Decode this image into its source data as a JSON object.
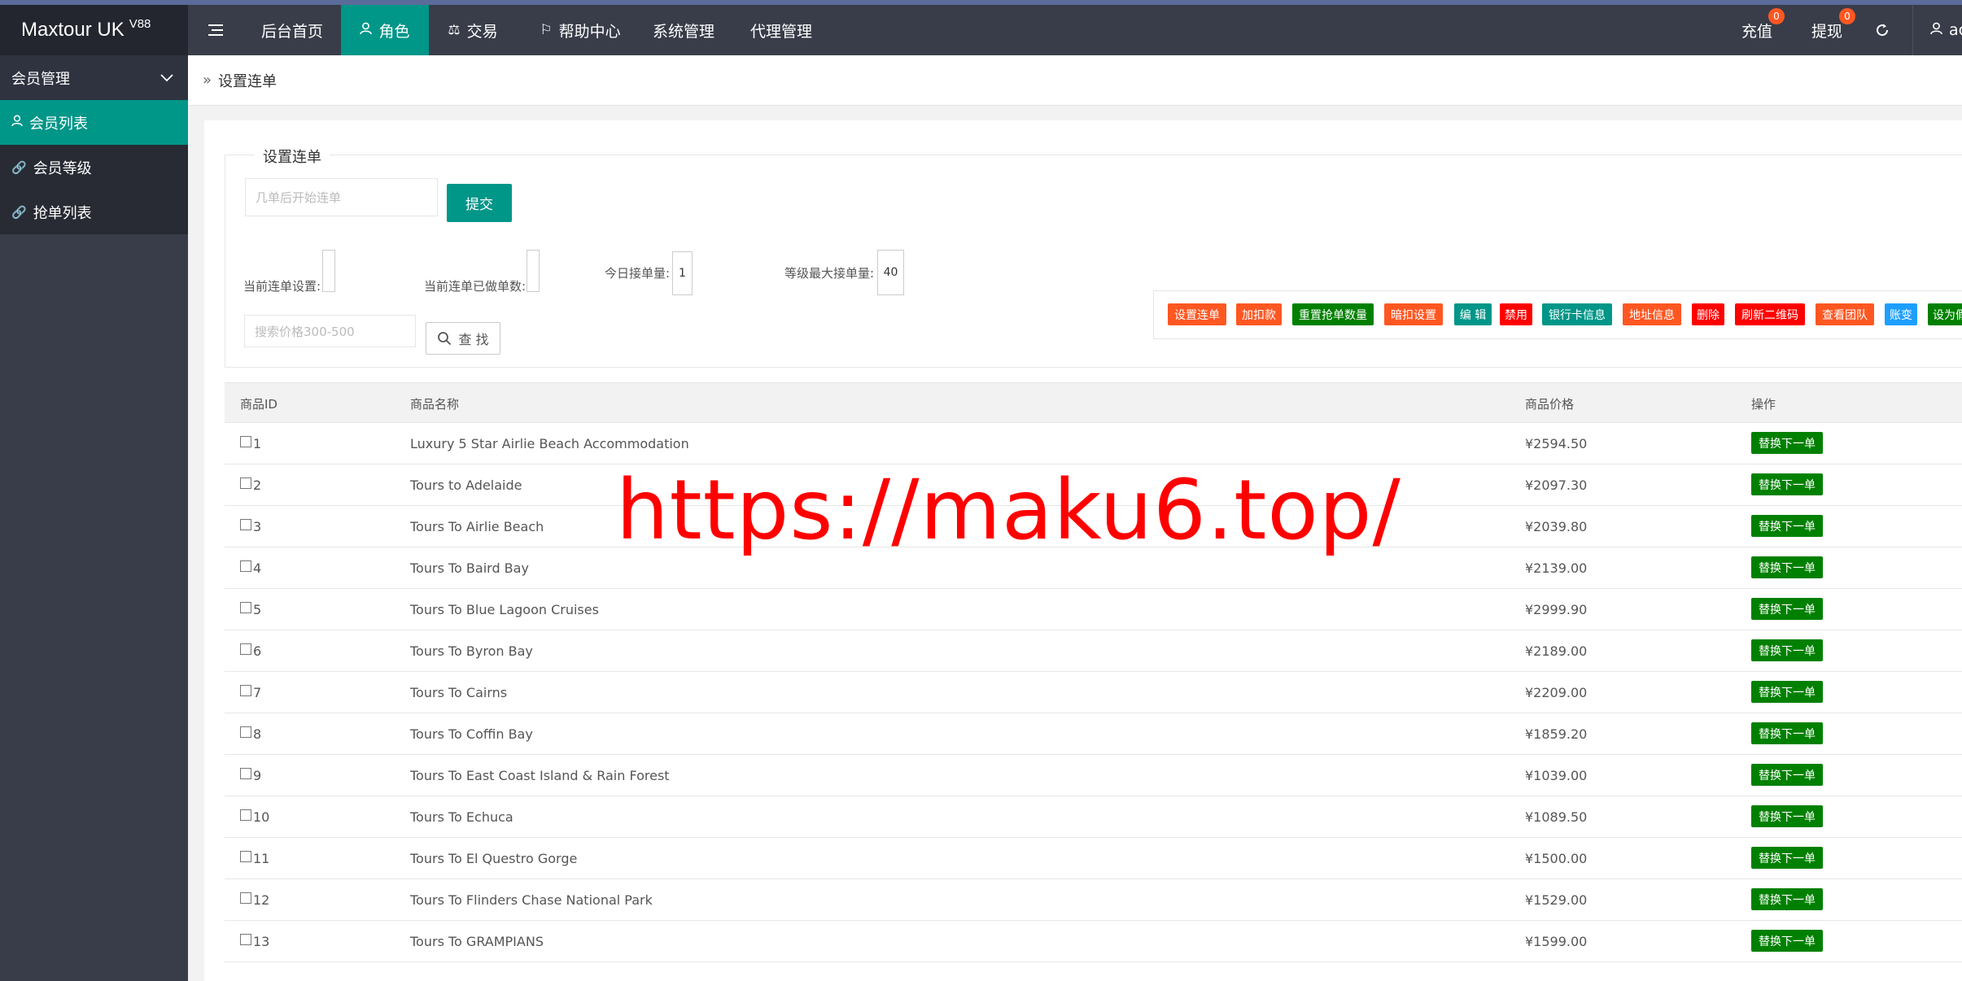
{
  "header": {
    "logo": "Maxtour UK",
    "logo_version": "V88",
    "menu_toggle_icon": "hamburger-icon",
    "nav": [
      {
        "label": "后台首页",
        "icon": ""
      },
      {
        "label": "角色",
        "icon": "user-icon"
      },
      {
        "label": "交易",
        "icon": "scale-icon"
      },
      {
        "label": "帮助中心",
        "icon": "flag-icon"
      },
      {
        "label": "系统管理",
        "icon": ""
      },
      {
        "label": "代理管理",
        "icon": ""
      }
    ],
    "right": {
      "recharge": "充值",
      "recharge_badge": "0",
      "withdraw": "提现",
      "withdraw_badge": "0",
      "refresh_icon": "refresh-icon",
      "user_partial": "ac"
    }
  },
  "sidebar": {
    "group": "会员管理",
    "items": [
      {
        "label": "会员列表",
        "icon": "user-icon"
      },
      {
        "label": "会员等级",
        "icon": "link-icon"
      },
      {
        "label": "抢单列表",
        "icon": "link-icon"
      }
    ]
  },
  "breadcrumb": "设置连单",
  "form": {
    "legend": "设置连单",
    "start_input_placeholder": "几单后开始连单",
    "submit": "提交",
    "current_setting_label": "当前连单设置:",
    "current_done_label": "当前连单已做单数:",
    "today_orders_label": "今日接单量:",
    "today_orders_value": "1",
    "max_orders_label": "等级最大接单量:",
    "max_orders_value": "40",
    "price_search_placeholder": "搜索价格300-500",
    "search_button": "查 找"
  },
  "ops": [
    {
      "label": "设置连单",
      "color": "#ff5722"
    },
    {
      "label": "加扣款",
      "color": "#ff5722"
    },
    {
      "label": "重置抢单数量",
      "color": "#008000"
    },
    {
      "label": "暗扣设置",
      "color": "#ff5722"
    },
    {
      "label": "编 辑",
      "color": "#009688"
    },
    {
      "label": "禁用",
      "color": "#ff0000"
    },
    {
      "label": "银行卡信息",
      "color": "#009688"
    },
    {
      "label": "地址信息",
      "color": "#ff5722"
    },
    {
      "label": "删除",
      "color": "#ff0000"
    },
    {
      "label": "刷新二维码",
      "color": "#ff0000"
    },
    {
      "label": "查看团队",
      "color": "#ff5722"
    },
    {
      "label": "账变",
      "color": "#1e9fff"
    },
    {
      "label": "设为假人",
      "color": "#008000"
    }
  ],
  "table": {
    "headers": [
      "商品ID",
      "商品名称",
      "商品价格",
      "操作"
    ],
    "action_label": "替换下一单",
    "rows": [
      {
        "id": "1",
        "name": "Luxury 5 Star Airlie Beach Accommodation",
        "price": "¥2594.50"
      },
      {
        "id": "2",
        "name": "Tours to Adelaide",
        "price": "¥2097.30"
      },
      {
        "id": "3",
        "name": "Tours To Airlie Beach",
        "price": "¥2039.80"
      },
      {
        "id": "4",
        "name": "Tours To Baird Bay",
        "price": "¥2139.00"
      },
      {
        "id": "5",
        "name": "Tours To Blue Lagoon Cruises",
        "price": "¥2999.90"
      },
      {
        "id": "6",
        "name": "Tours To Byron Bay",
        "price": "¥2189.00"
      },
      {
        "id": "7",
        "name": "Tours To Cairns",
        "price": "¥2209.00"
      },
      {
        "id": "8",
        "name": "Tours To Coffin Bay",
        "price": "¥1859.20"
      },
      {
        "id": "9",
        "name": "Tours To East Coast Island & Rain Forest",
        "price": "¥1039.00"
      },
      {
        "id": "10",
        "name": "Tours To Echuca",
        "price": "¥1089.50"
      },
      {
        "id": "11",
        "name": "Tours To El Questro Gorge",
        "price": "¥1500.00"
      },
      {
        "id": "12",
        "name": "Tours To Flinders Chase National Park",
        "price": "¥1529.00"
      },
      {
        "id": "13",
        "name": "Tours To GRAMPIANS",
        "price": "¥1599.00"
      }
    ]
  },
  "watermark": "https://maku6.top/"
}
